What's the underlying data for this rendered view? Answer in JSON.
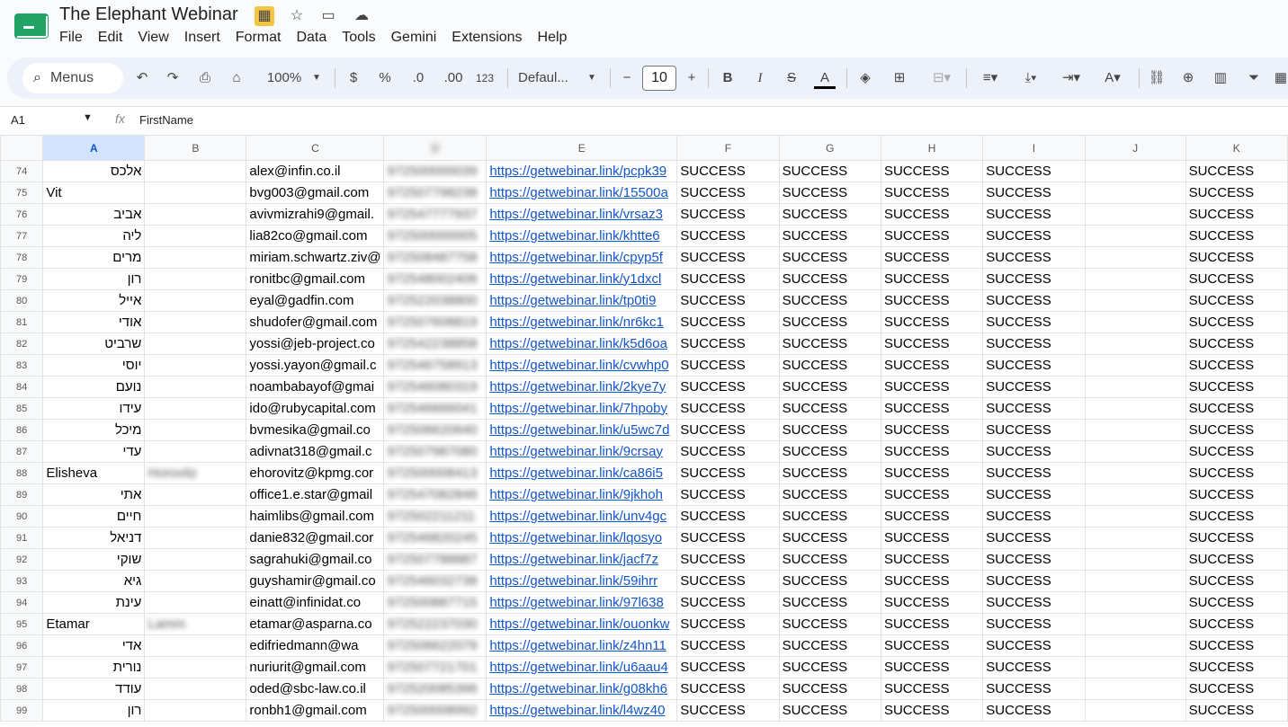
{
  "doc": {
    "title": "The Elephant Webinar"
  },
  "menus": [
    "File",
    "Edit",
    "View",
    "Insert",
    "Format",
    "Data",
    "Tools",
    "Gemini",
    "Extensions",
    "Help"
  ],
  "toolbar": {
    "search_label": "Menus",
    "zoom": "100%",
    "currency": "$",
    "percent": "%",
    "dec_dec": ".0",
    "inc_dec": ".00",
    "format_123": "123",
    "font": "Defaul...",
    "font_size": "10"
  },
  "formula": {
    "cell": "A1",
    "fx": "fx",
    "value": "FirstName"
  },
  "columns": [
    "A",
    "B",
    "C",
    "D",
    "E",
    "F",
    "G",
    "H",
    "I",
    "J",
    "K"
  ],
  "rows": [
    {
      "n": "74",
      "a": "אלכס",
      "a_rtl": true,
      "b": "",
      "c": "alex@infin.co.il",
      "d": "972500000039",
      "e": "https://getwebinar.link/pcpk39",
      "f": "SUCCESS",
      "g": "SUCCESS",
      "h": "SUCCESS",
      "i": "SUCCESS",
      "j": "",
      "k": "SUCCESS"
    },
    {
      "n": "75",
      "a": "Vit",
      "a_rtl": false,
      "b": "",
      "c": "bvg003@gmail.com",
      "d": "972507798238",
      "e": "https://getwebinar.link/15500a",
      "f": "SUCCESS",
      "g": "SUCCESS",
      "h": "SUCCESS",
      "i": "SUCCESS",
      "j": "",
      "k": "SUCCESS"
    },
    {
      "n": "76",
      "a": "אביב",
      "a_rtl": true,
      "b": "",
      "c": "avivmizrahi9@gmail.",
      "d": "972547777937",
      "e": "https://getwebinar.link/vrsaz3",
      "f": "SUCCESS",
      "g": "SUCCESS",
      "h": "SUCCESS",
      "i": "SUCCESS",
      "j": "",
      "k": "SUCCESS"
    },
    {
      "n": "77",
      "a": "ליה",
      "a_rtl": true,
      "b": "",
      "c": "lia82co@gmail.com",
      "d": "972500000005",
      "e": "https://getwebinar.link/khtte6",
      "f": "SUCCESS",
      "g": "SUCCESS",
      "h": "SUCCESS",
      "i": "SUCCESS",
      "j": "",
      "k": "SUCCESS"
    },
    {
      "n": "78",
      "a": "מרים",
      "a_rtl": true,
      "b": "",
      "c": "miriam.schwartz.ziv@",
      "d": "972508487758",
      "e": "https://getwebinar.link/cpyp5f",
      "f": "SUCCESS",
      "g": "SUCCESS",
      "h": "SUCCESS",
      "i": "SUCCESS",
      "j": "",
      "k": "SUCCESS"
    },
    {
      "n": "79",
      "a": "רון",
      "a_rtl": true,
      "b": "",
      "c": "ronitbc@gmail.com",
      "d": "972548002406",
      "e": "https://getwebinar.link/y1dxcl",
      "f": "SUCCESS",
      "g": "SUCCESS",
      "h": "SUCCESS",
      "i": "SUCCESS",
      "j": "",
      "k": "SUCCESS"
    },
    {
      "n": "80",
      "a": "אייל",
      "a_rtl": true,
      "b": "",
      "c": "eyal@gadfin.com",
      "d": "972522038800",
      "e": "https://getwebinar.link/tp0ti9",
      "f": "SUCCESS",
      "g": "SUCCESS",
      "h": "SUCCESS",
      "i": "SUCCESS",
      "j": "",
      "k": "SUCCESS"
    },
    {
      "n": "81",
      "a": "אודי",
      "a_rtl": true,
      "b": "",
      "c": "shudofer@gmail.com",
      "d": "972507608819",
      "e": "https://getwebinar.link/nr6kc1",
      "f": "SUCCESS",
      "g": "SUCCESS",
      "h": "SUCCESS",
      "i": "SUCCESS",
      "j": "",
      "k": "SUCCESS"
    },
    {
      "n": "82",
      "a": "שרביט",
      "a_rtl": true,
      "b": "",
      "c": "yossi@jeb-project.co",
      "d": "972542238858",
      "e": "https://getwebinar.link/k5d6oa",
      "f": "SUCCESS",
      "g": "SUCCESS",
      "h": "SUCCESS",
      "i": "SUCCESS",
      "j": "",
      "k": "SUCCESS"
    },
    {
      "n": "83",
      "a": "יוסי",
      "a_rtl": true,
      "b": "",
      "c": "yossi.yayon@gmail.c",
      "d": "972546758913",
      "e": "https://getwebinar.link/cvwhp0",
      "f": "SUCCESS",
      "g": "SUCCESS",
      "h": "SUCCESS",
      "i": "SUCCESS",
      "j": "",
      "k": "SUCCESS"
    },
    {
      "n": "84",
      "a": "נועם",
      "a_rtl": true,
      "b": "",
      "c": "noambabayof@gmai",
      "d": "972546080319",
      "e": "https://getwebinar.link/2kye7y",
      "f": "SUCCESS",
      "g": "SUCCESS",
      "h": "SUCCESS",
      "i": "SUCCESS",
      "j": "",
      "k": "SUCCESS"
    },
    {
      "n": "85",
      "a": "עידו",
      "a_rtl": true,
      "b": "",
      "c": "ido@rubycapital.com",
      "d": "972546666041",
      "e": "https://getwebinar.link/7hpoby",
      "f": "SUCCESS",
      "g": "SUCCESS",
      "h": "SUCCESS",
      "i": "SUCCESS",
      "j": "",
      "k": "SUCCESS"
    },
    {
      "n": "86",
      "a": "מיכל",
      "a_rtl": true,
      "b": "",
      "c": "bvmesika@gmail.co",
      "d": "972506620640",
      "e": "https://getwebinar.link/u5wc7d",
      "f": "SUCCESS",
      "g": "SUCCESS",
      "h": "SUCCESS",
      "i": "SUCCESS",
      "j": "",
      "k": "SUCCESS"
    },
    {
      "n": "87",
      "a": "עדי",
      "a_rtl": true,
      "b": "",
      "c": "adivnat318@gmail.c",
      "d": "972507987080",
      "e": "https://getwebinar.link/9crsay",
      "f": "SUCCESS",
      "g": "SUCCESS",
      "h": "SUCCESS",
      "i": "SUCCESS",
      "j": "",
      "k": "SUCCESS"
    },
    {
      "n": "88",
      "a": "Elisheva",
      "a_rtl": false,
      "b": "Horovitz",
      "c": "ehorovitz@kpmg.cor",
      "d": "972500008413",
      "e": "https://getwebinar.link/ca86i5",
      "f": "SUCCESS",
      "g": "SUCCESS",
      "h": "SUCCESS",
      "i": "SUCCESS",
      "j": "",
      "k": "SUCCESS"
    },
    {
      "n": "89",
      "a": "אתי",
      "a_rtl": true,
      "b": "",
      "c": "office1.e.star@gmail",
      "d": "972547082846",
      "e": "https://getwebinar.link/9jkhoh",
      "f": "SUCCESS",
      "g": "SUCCESS",
      "h": "SUCCESS",
      "i": "SUCCESS",
      "j": "",
      "k": "SUCCESS"
    },
    {
      "n": "90",
      "a": "חיים",
      "a_rtl": true,
      "b": "",
      "c": "haimlibs@gmail.com",
      "d": "972502211211",
      "e": "https://getwebinar.link/unv4gc",
      "f": "SUCCESS",
      "g": "SUCCESS",
      "h": "SUCCESS",
      "i": "SUCCESS",
      "j": "",
      "k": "SUCCESS"
    },
    {
      "n": "91",
      "a": "דניאל",
      "a_rtl": true,
      "b": "",
      "c": "danie832@gmail.cor",
      "d": "972546820245",
      "e": "https://getwebinar.link/lqosyo",
      "f": "SUCCESS",
      "g": "SUCCESS",
      "h": "SUCCESS",
      "i": "SUCCESS",
      "j": "",
      "k": "SUCCESS"
    },
    {
      "n": "92",
      "a": "שוקי",
      "a_rtl": true,
      "b": "",
      "c": "sagrahuki@gmail.co",
      "d": "972507788887",
      "e": "https://getwebinar.link/jacf7z",
      "f": "SUCCESS",
      "g": "SUCCESS",
      "h": "SUCCESS",
      "i": "SUCCESS",
      "j": "",
      "k": "SUCCESS"
    },
    {
      "n": "93",
      "a": "גיא",
      "a_rtl": true,
      "b": "",
      "c": "guyshamir@gmail.co",
      "d": "972546032738",
      "e": "https://getwebinar.link/59ihrr",
      "f": "SUCCESS",
      "g": "SUCCESS",
      "h": "SUCCESS",
      "i": "SUCCESS",
      "j": "",
      "k": "SUCCESS"
    },
    {
      "n": "94",
      "a": "עינת",
      "a_rtl": true,
      "b": "",
      "c": "einatt@infinidat.co",
      "d": "972500887715",
      "e": "https://getwebinar.link/97l638",
      "f": "SUCCESS",
      "g": "SUCCESS",
      "h": "SUCCESS",
      "i": "SUCCESS",
      "j": "",
      "k": "SUCCESS"
    },
    {
      "n": "95",
      "a": "Etamar",
      "a_rtl": false,
      "b": "Lamm",
      "c": "etamar@asparna.co",
      "d": "972522237030",
      "e": "https://getwebinar.link/ouonkw",
      "f": "SUCCESS",
      "g": "SUCCESS",
      "h": "SUCCESS",
      "i": "SUCCESS",
      "j": "",
      "k": "SUCCESS"
    },
    {
      "n": "96",
      "a": "אדי",
      "a_rtl": true,
      "b": "",
      "c": "edifriedmann@wa",
      "d": "972506622079",
      "e": "https://getwebinar.link/z4hn11",
      "f": "SUCCESS",
      "g": "SUCCESS",
      "h": "SUCCESS",
      "i": "SUCCESS",
      "j": "",
      "k": "SUCCESS"
    },
    {
      "n": "97",
      "a": "נורית",
      "a_rtl": true,
      "b": "",
      "c": "nuriurit@gmail.com",
      "d": "972507721701",
      "e": "https://getwebinar.link/u6aau4",
      "f": "SUCCESS",
      "g": "SUCCESS",
      "h": "SUCCESS",
      "i": "SUCCESS",
      "j": "",
      "k": "SUCCESS"
    },
    {
      "n": "98",
      "a": "עודד",
      "a_rtl": true,
      "b": "",
      "c": "oded@sbc-law.co.il",
      "d": "972520085396",
      "e": "https://getwebinar.link/g08kh6",
      "f": "SUCCESS",
      "g": "SUCCESS",
      "h": "SUCCESS",
      "i": "SUCCESS",
      "j": "",
      "k": "SUCCESS"
    },
    {
      "n": "99",
      "a": "רון",
      "a_rtl": true,
      "b": "",
      "c": "ronbh1@gmail.com",
      "d": "972500008992",
      "e": "https://getwebinar.link/l4wz40",
      "f": "SUCCESS",
      "g": "SUCCESS",
      "h": "SUCCESS",
      "i": "SUCCESS",
      "j": "",
      "k": "SUCCESS"
    }
  ]
}
